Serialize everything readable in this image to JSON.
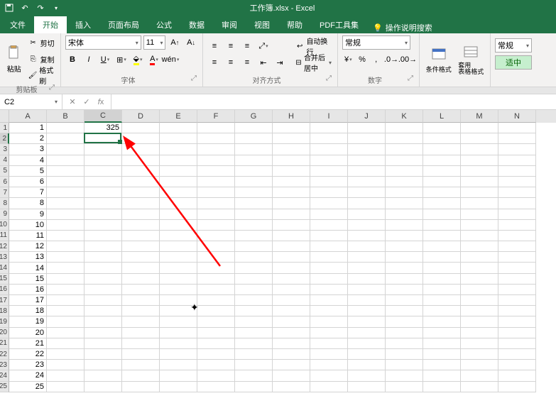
{
  "title": "工作簿.xlsx - Excel",
  "tabs": {
    "file": "文件",
    "home": "开始",
    "insert": "插入",
    "layout": "页面布局",
    "formulas": "公式",
    "data": "数据",
    "review": "审阅",
    "view": "视图",
    "help": "帮助",
    "pdf": "PDF工具集",
    "tellme": "操作说明搜索"
  },
  "ribbon": {
    "clipboard": {
      "paste": "粘贴",
      "cut": "剪切",
      "copy": "复制",
      "brush": "格式刷",
      "label": "剪贴板"
    },
    "font": {
      "name": "宋体",
      "size": "11",
      "label": "字体"
    },
    "align": {
      "wrap": "自动换行",
      "merge": "合并后居中",
      "label": "对齐方式"
    },
    "number": {
      "fmt": "常规",
      "label": "数字"
    },
    "styles": {
      "cond": "条件格式",
      "table": "套用\n表格格式",
      "normal": "常规",
      "good": "适中",
      "label": ""
    }
  },
  "namebox": "C2",
  "columns": [
    "A",
    "B",
    "C",
    "D",
    "E",
    "F",
    "G",
    "H",
    "I",
    "J",
    "K",
    "L",
    "M",
    "N"
  ],
  "rows": 25,
  "cellData": {
    "C1": "325",
    "A": [
      "1",
      "2",
      "3",
      "4",
      "5",
      "6",
      "7",
      "8",
      "9",
      "10",
      "11",
      "12",
      "13",
      "14",
      "15",
      "16",
      "17",
      "18",
      "19",
      "20",
      "21",
      "22",
      "23",
      "24",
      "25"
    ]
  },
  "activeCell": {
    "row": 2,
    "col": "C"
  }
}
